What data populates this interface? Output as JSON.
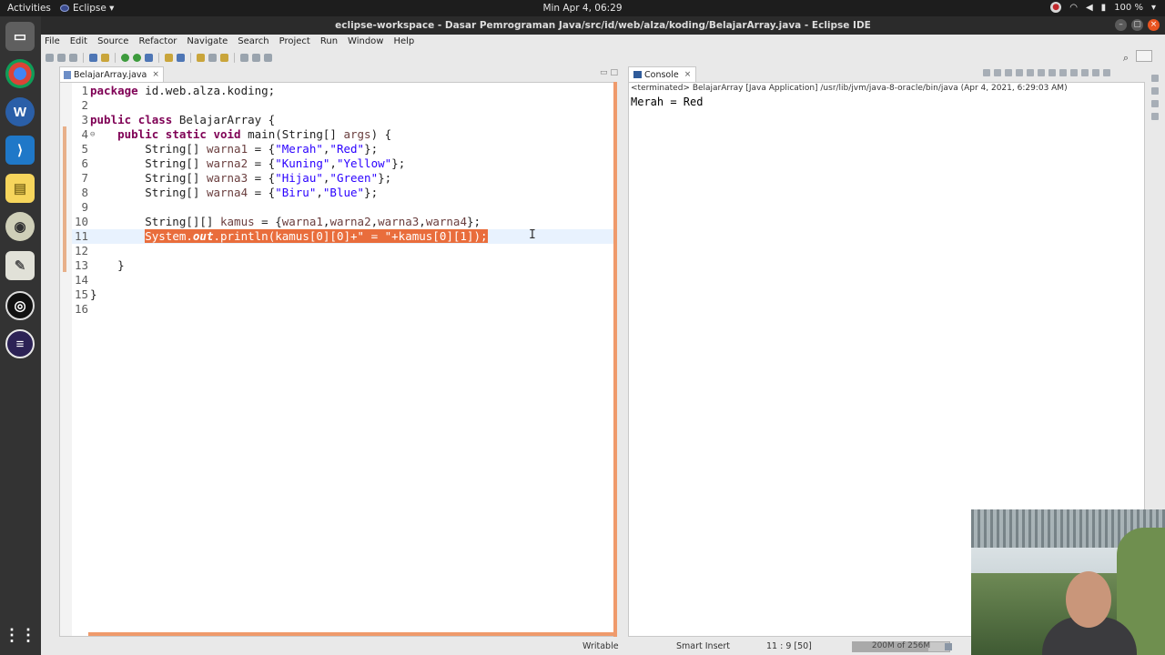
{
  "topbar": {
    "activities": "Activities",
    "app": "Eclipse ▾",
    "clock": "Min Apr  4, 06:29",
    "battery": "100 %"
  },
  "window": {
    "title": "eclipse-workspace - Dasar Pemrograman Java/src/id/web/alza/koding/BelajarArray.java - Eclipse IDE"
  },
  "menu": [
    "File",
    "Edit",
    "Source",
    "Refactor",
    "Navigate",
    "Search",
    "Project",
    "Run",
    "Window",
    "Help"
  ],
  "editor": {
    "tab_label": "BelajarArray.java",
    "lines": [
      {
        "n": "1",
        "code": "package id.web.alza.koding;"
      },
      {
        "n": "2",
        "code": ""
      },
      {
        "n": "3",
        "code": "public class BelajarArray {"
      },
      {
        "n": "4",
        "code": "    public static void main(String[] args) {"
      },
      {
        "n": "5",
        "code": "        String[] warna1 = {\"Merah\",\"Red\"};"
      },
      {
        "n": "6",
        "code": "        String[] warna2 = {\"Kuning\",\"Yellow\"};"
      },
      {
        "n": "7",
        "code": "        String[] warna3 = {\"Hijau\",\"Green\"};"
      },
      {
        "n": "8",
        "code": "        String[] warna4 = {\"Biru\",\"Blue\"};"
      },
      {
        "n": "9",
        "code": ""
      },
      {
        "n": "10",
        "code": "        String[][] kamus = {warna1,warna2,warna3,warna4};"
      },
      {
        "n": "11",
        "code": "        System.out.println(kamus[0][0]+\" = \"+kamus[0][1]);"
      },
      {
        "n": "12",
        "code": ""
      },
      {
        "n": "13",
        "code": "    }"
      },
      {
        "n": "14",
        "code": ""
      },
      {
        "n": "15",
        "code": "}"
      },
      {
        "n": "16",
        "code": ""
      }
    ]
  },
  "console": {
    "tab_label": "Console",
    "status": "<terminated> BelajarArray [Java Application] /usr/lib/jvm/java-8-oracle/bin/java (Apr 4, 2021, 6:29:03 AM)",
    "output": "Merah = Red"
  },
  "statusbar": {
    "writable": "Writable",
    "insert_mode": "Smart Insert",
    "position": "11 : 9 [50]",
    "heap": "200M of 256M",
    "heap_fraction": 0.78
  }
}
